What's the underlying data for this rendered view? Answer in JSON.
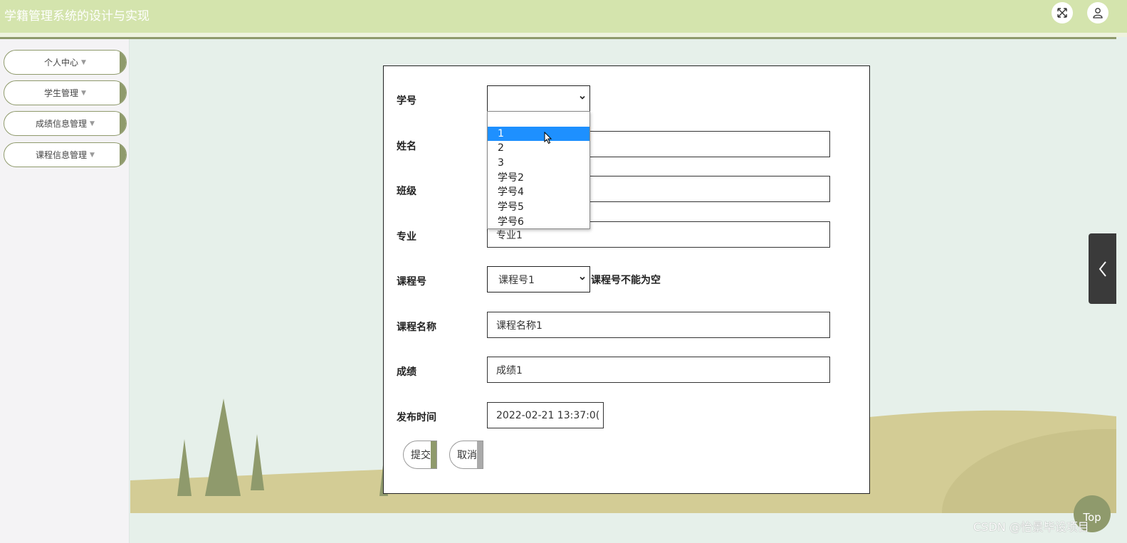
{
  "app": {
    "title": "学籍管理系统的设计与实现"
  },
  "header": {
    "icons": [
      "fullscreen-icon",
      "user-icon"
    ],
    "colors": {
      "bar": "#d4e4ad",
      "accent": "#8e9a6c"
    }
  },
  "sidebar": {
    "items": [
      {
        "label": "个人中心"
      },
      {
        "label": "学生管理"
      },
      {
        "label": "成绩信息管理"
      },
      {
        "label": "课程信息管理"
      }
    ]
  },
  "form": {
    "student_id": {
      "label": "学号",
      "value": ""
    },
    "name": {
      "label": "姓名",
      "value": ""
    },
    "class": {
      "label": "班级",
      "value": ""
    },
    "major": {
      "label": "专业",
      "value": "专业1"
    },
    "course_id": {
      "label": "课程号",
      "value": "课程号1",
      "error": "课程号不能为空"
    },
    "course_name": {
      "label": "课程名称",
      "value": "课程名称1"
    },
    "score": {
      "label": "成绩",
      "value": "成绩1"
    },
    "publish_time": {
      "label": "发布时间",
      "value": "2022-02-21 13:37:0("
    },
    "submit_label": "提交",
    "cancel_label": "取消"
  },
  "dropdown": {
    "options": [
      "",
      "1",
      "2",
      "3",
      "学号2",
      "学号4",
      "学号5",
      "学号6"
    ],
    "highlighted": "1"
  },
  "misc": {
    "top_button_label": "Top",
    "watermark": "CSDN @怡景毕设项目"
  }
}
